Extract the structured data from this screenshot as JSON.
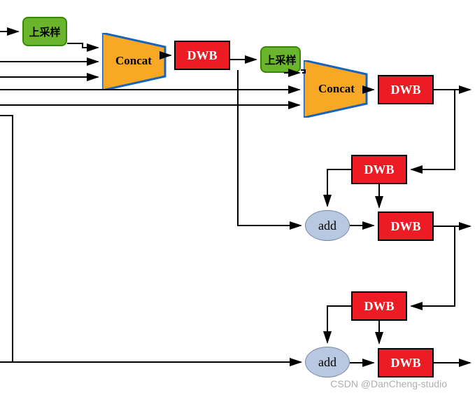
{
  "nodes": {
    "upsample1": {
      "label": "上采样"
    },
    "upsample2": {
      "label": "上采样"
    },
    "concat1": {
      "label": "Concat"
    },
    "concat2": {
      "label": "Concat"
    },
    "dwb1": {
      "label": "DWB"
    },
    "dwb2": {
      "label": "DWB"
    },
    "dwb3": {
      "label": "DWB"
    },
    "dwb4": {
      "label": "DWB"
    },
    "dwb5": {
      "label": "DWB"
    },
    "dwb6": {
      "label": "DWB"
    },
    "add1": {
      "label": "add"
    },
    "add2": {
      "label": "add"
    }
  },
  "watermark": "CSDN @DanCheng-studio"
}
